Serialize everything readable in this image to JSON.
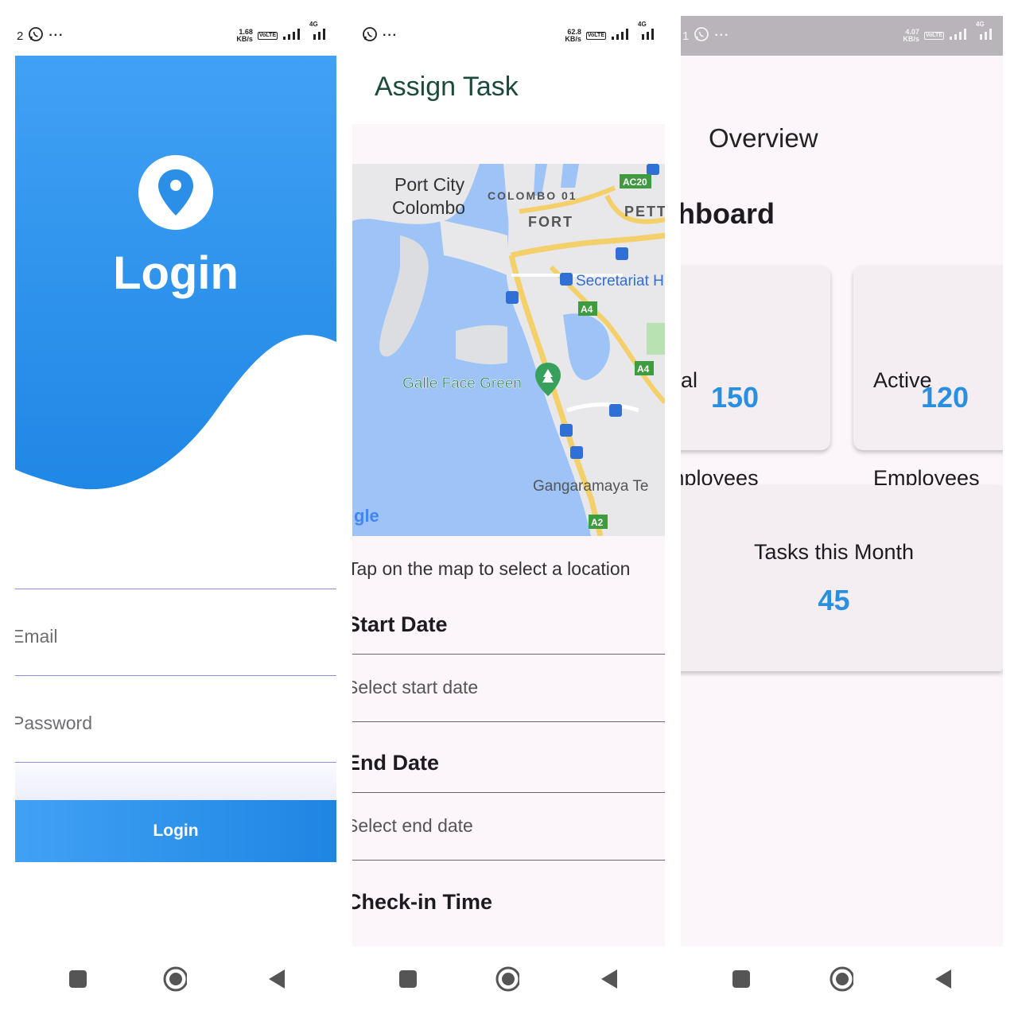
{
  "login": {
    "status": {
      "left": "2",
      "speed_top": "1.68",
      "speed_bottom": "KB/s",
      "net": "4G",
      "lte": "Vo LTE"
    },
    "title": "Login",
    "email_placeholder": "Email",
    "password_placeholder": "Password",
    "button_label": "Login",
    "colors": {
      "primary": "#2b8fe8",
      "gradient_top": "#41a1f4",
      "gradient_bottom": "#1d86e3"
    }
  },
  "assign": {
    "status": {
      "speed_top": "62.8",
      "speed_bottom": "KB/s",
      "net": "4G",
      "lte": "Vo LTE"
    },
    "title": "Assign Task",
    "map": {
      "labels": {
        "port_city_1": "Port City",
        "port_city_2": "Colombo",
        "colombo01": "COLOMBO 01",
        "fort": "FORT",
        "pettah": "PETT",
        "secretariat": "Secretariat H",
        "galle_face": "Galle Face Green",
        "gangaramaya": "Gangaramaya Te",
        "google": "gle"
      },
      "road_badges": {
        "ac20": "AC20",
        "a4_1": "A4",
        "a4_2": "A4",
        "a2": "A2"
      }
    },
    "hint": "Tap on the map to select a location",
    "start_label": "Start Date",
    "start_placeholder": "Select start date",
    "end_label": "End Date",
    "end_placeholder": "Select end date",
    "checkin_label": "Check-in Time"
  },
  "dashboard": {
    "status": {
      "left": "1",
      "speed_top": "4.07",
      "speed_bottom": "KB/s",
      "net": "4G",
      "lte": "Vo LTE"
    },
    "overview": "Overview",
    "title": "Dashboard",
    "cards": [
      {
        "label_1": "Total",
        "label_2": "Employees",
        "value": "150"
      },
      {
        "label_1": "Active",
        "label_2": "Employees",
        "value": "120"
      }
    ],
    "tasks": {
      "label": "Tasks this Month",
      "value": "45"
    },
    "accent": "#2b8fe0"
  },
  "nav": {
    "icons": [
      "recents-square-icon",
      "home-circle-icon",
      "back-triangle-icon"
    ]
  }
}
